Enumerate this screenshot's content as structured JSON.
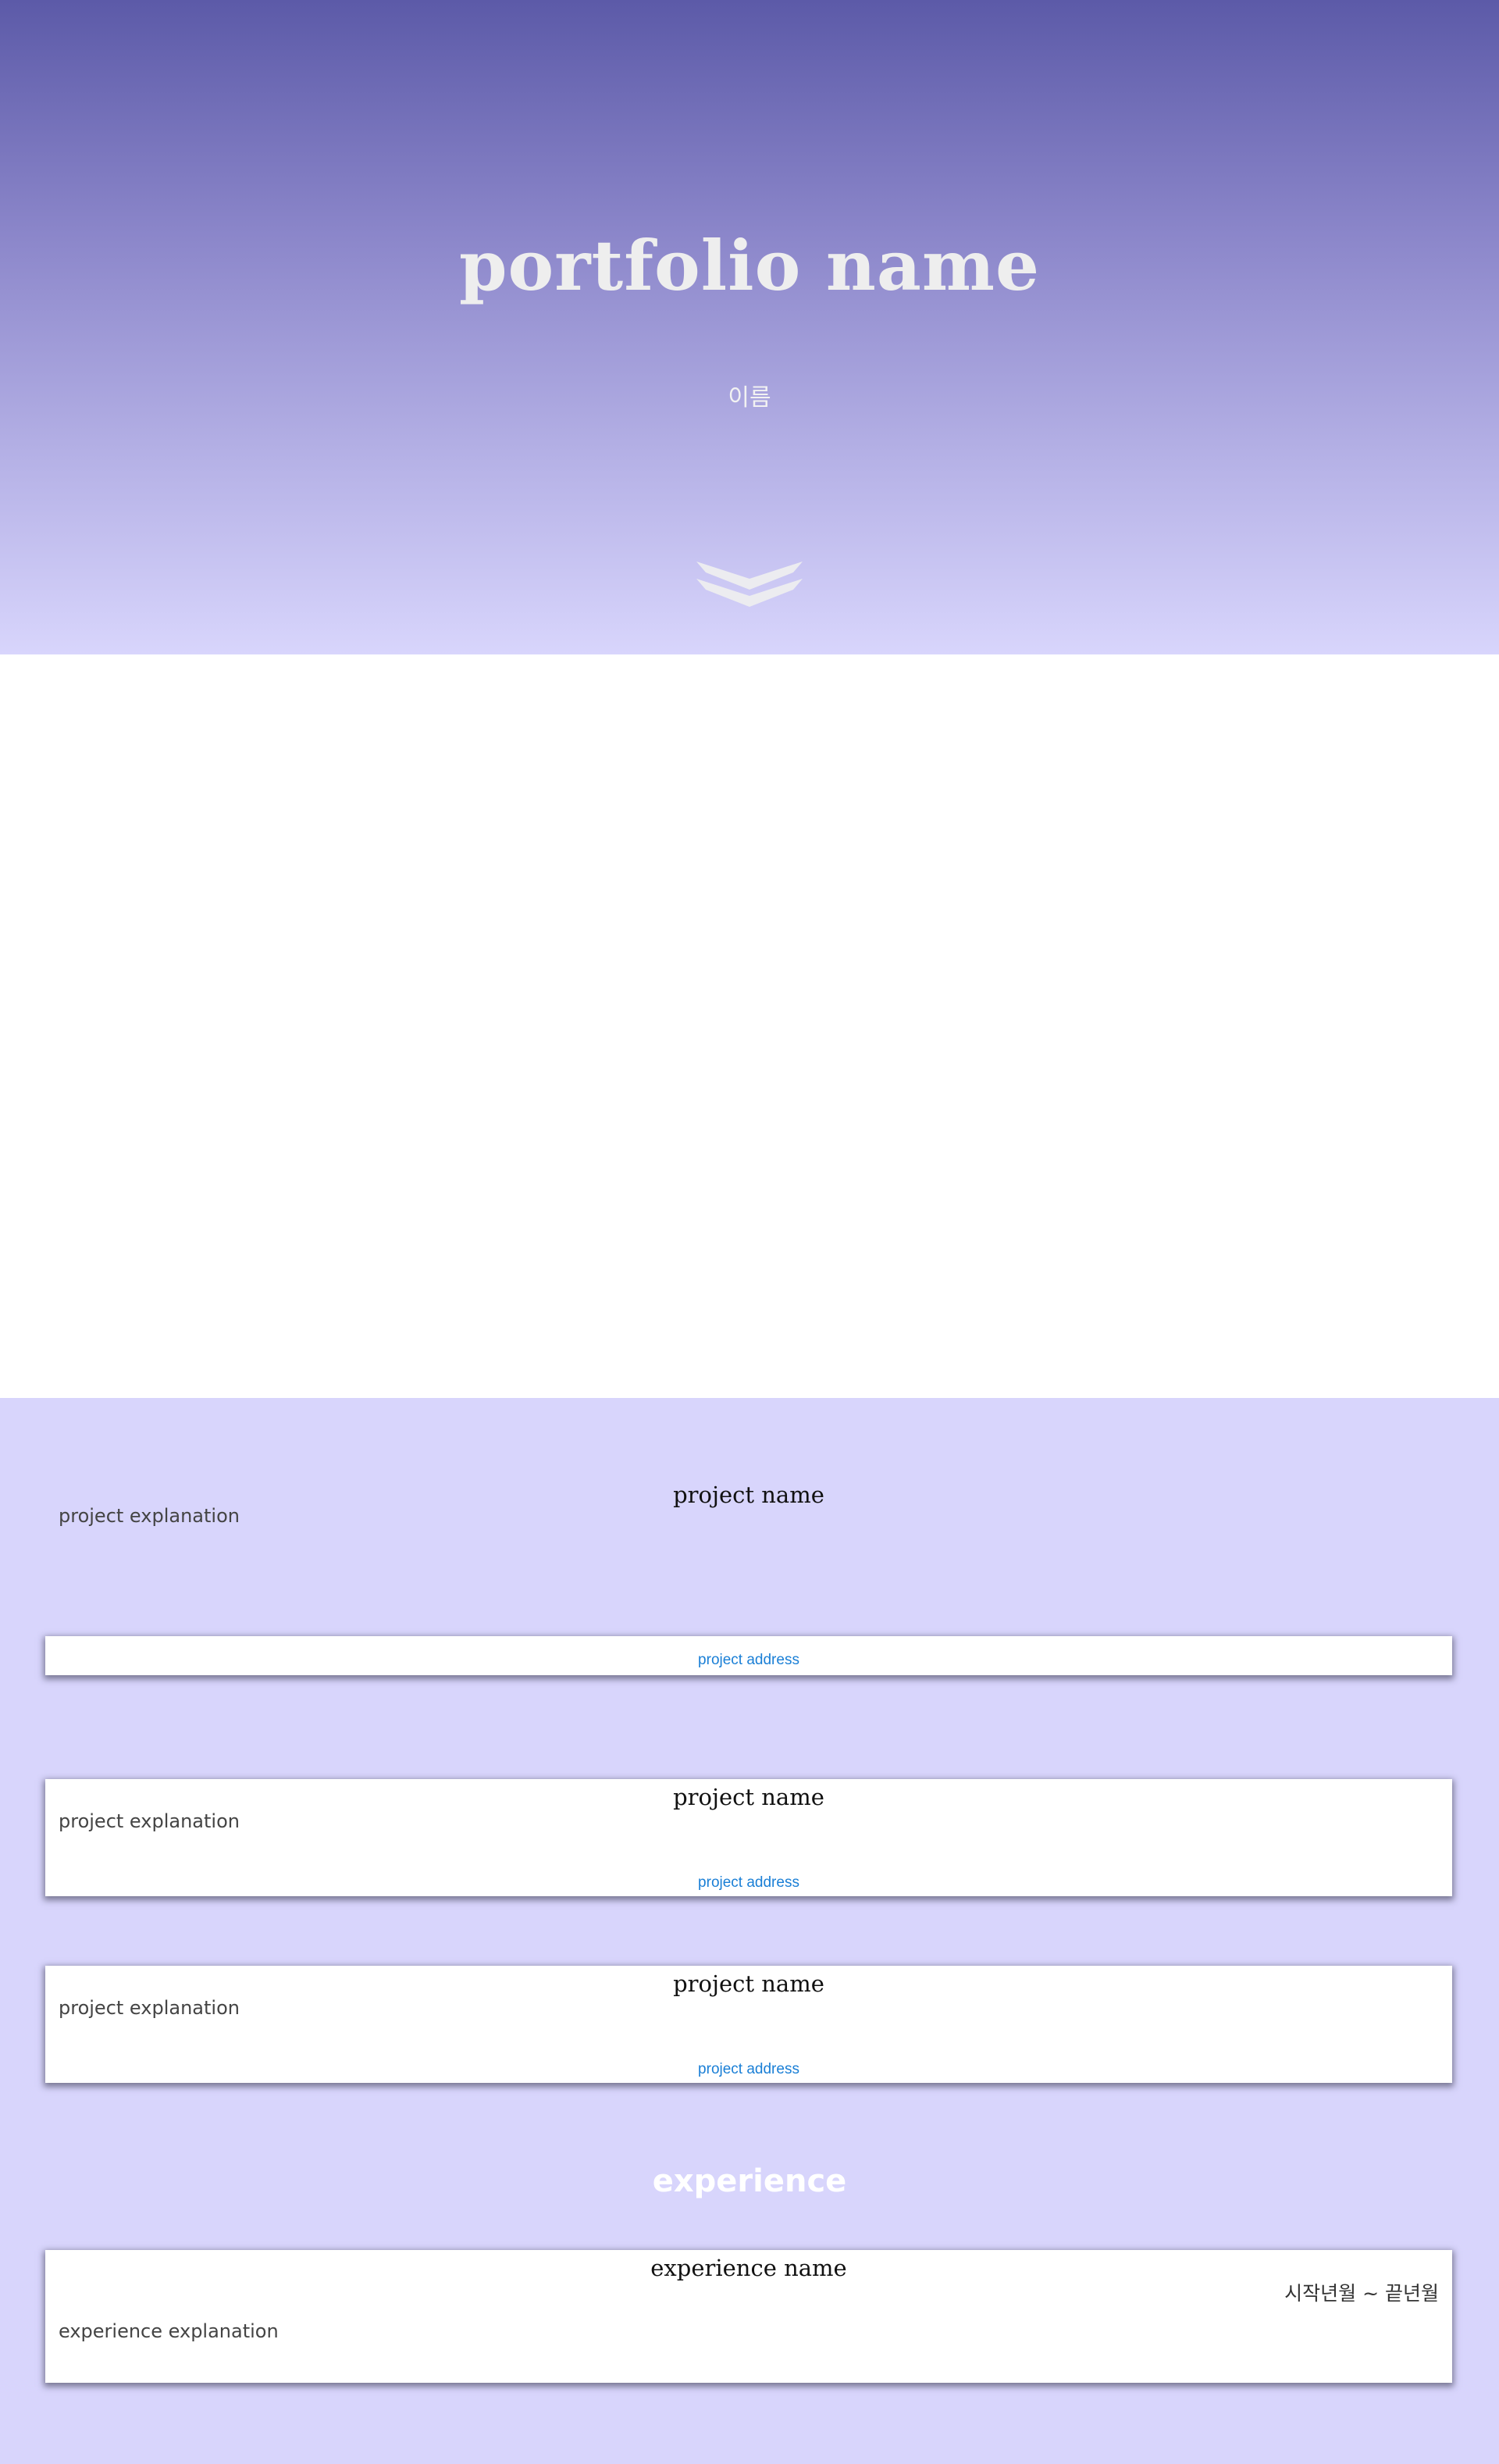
{
  "hero": {
    "title": "portfolio name",
    "subtitle": "이름",
    "scroll_icon": "double-chevron-down-icon"
  },
  "projects": {
    "items": [
      {
        "name": "project name",
        "explanation": "project explanation",
        "address": "project address"
      },
      {
        "name": "project name",
        "explanation": "project explanation",
        "address": "project address"
      },
      {
        "name": "project name",
        "explanation": "project explanation",
        "address": "project address"
      }
    ]
  },
  "experience": {
    "heading": "experience",
    "items": [
      {
        "name": "experience name",
        "period": "시작년월 ~ 끝년월",
        "explanation": "experience explanation"
      }
    ]
  },
  "colors": {
    "hero_top": "#5c5aa8",
    "hero_bottom": "#d8d5fc",
    "section_background": "#d8d5fc",
    "link": "#1a7fd6"
  }
}
